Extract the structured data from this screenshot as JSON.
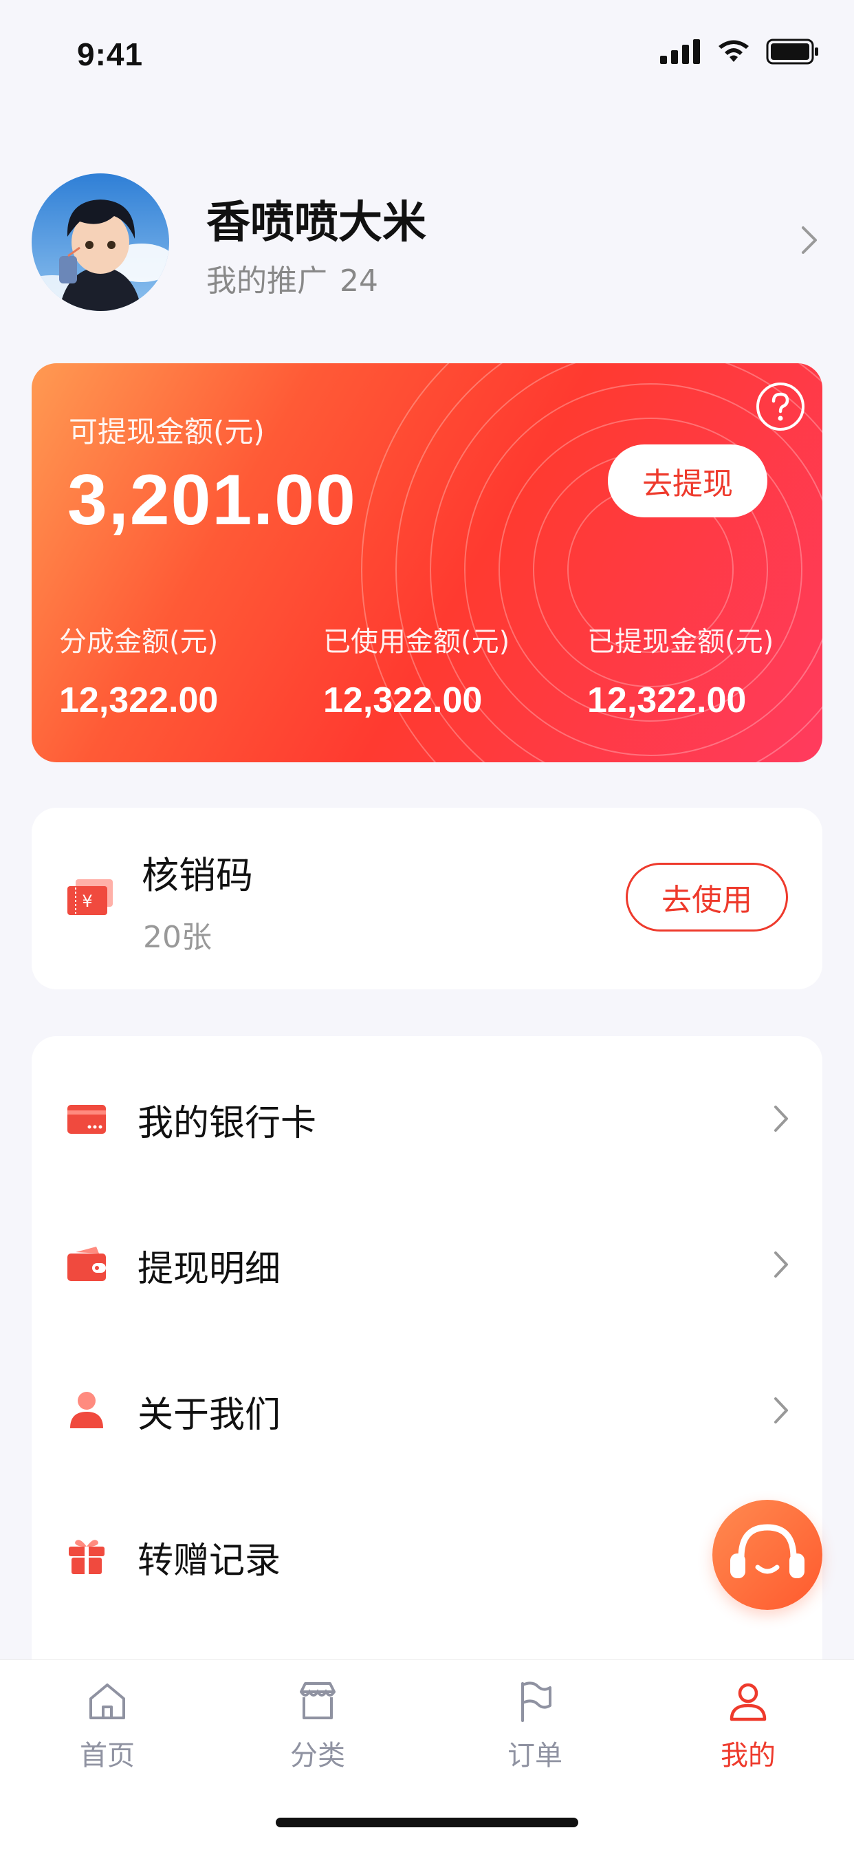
{
  "status_bar": {
    "time": "9:41"
  },
  "profile": {
    "name": "香喷喷大米",
    "promo_label": "我的推广",
    "promo_count": "24"
  },
  "balance": {
    "withdrawable_label": "可提现金额(元)",
    "withdrawable_amount": "3,201.00",
    "withdraw_button": "去提现",
    "stats": [
      {
        "label": "分成金额(元)",
        "value": "12,322.00"
      },
      {
        "label": "已使用金额(元)",
        "value": "12,322.00"
      },
      {
        "label": "已提现金额(元)",
        "value": "12,322.00"
      }
    ]
  },
  "voucher": {
    "title": "核销码",
    "count": "20张",
    "use_button": "去使用"
  },
  "menu": {
    "items": [
      {
        "label": "我的银行卡",
        "icon": "bank-card-icon"
      },
      {
        "label": "提现明细",
        "icon": "wallet-icon"
      },
      {
        "label": "关于我们",
        "icon": "person-icon"
      },
      {
        "label": "转赠记录",
        "icon": "gift-icon"
      }
    ]
  },
  "tabbar": {
    "tabs": [
      {
        "label": "首页",
        "icon": "home-icon"
      },
      {
        "label": "分类",
        "icon": "store-icon"
      },
      {
        "label": "订单",
        "icon": "flag-icon"
      },
      {
        "label": "我的",
        "icon": "user-icon",
        "active": true
      }
    ]
  },
  "colors": {
    "accent": "#ee3a2c",
    "card_gradient_start": "#ff9a52",
    "card_gradient_end": "#ff3b5e",
    "tab_inactive": "#8f92a1"
  }
}
